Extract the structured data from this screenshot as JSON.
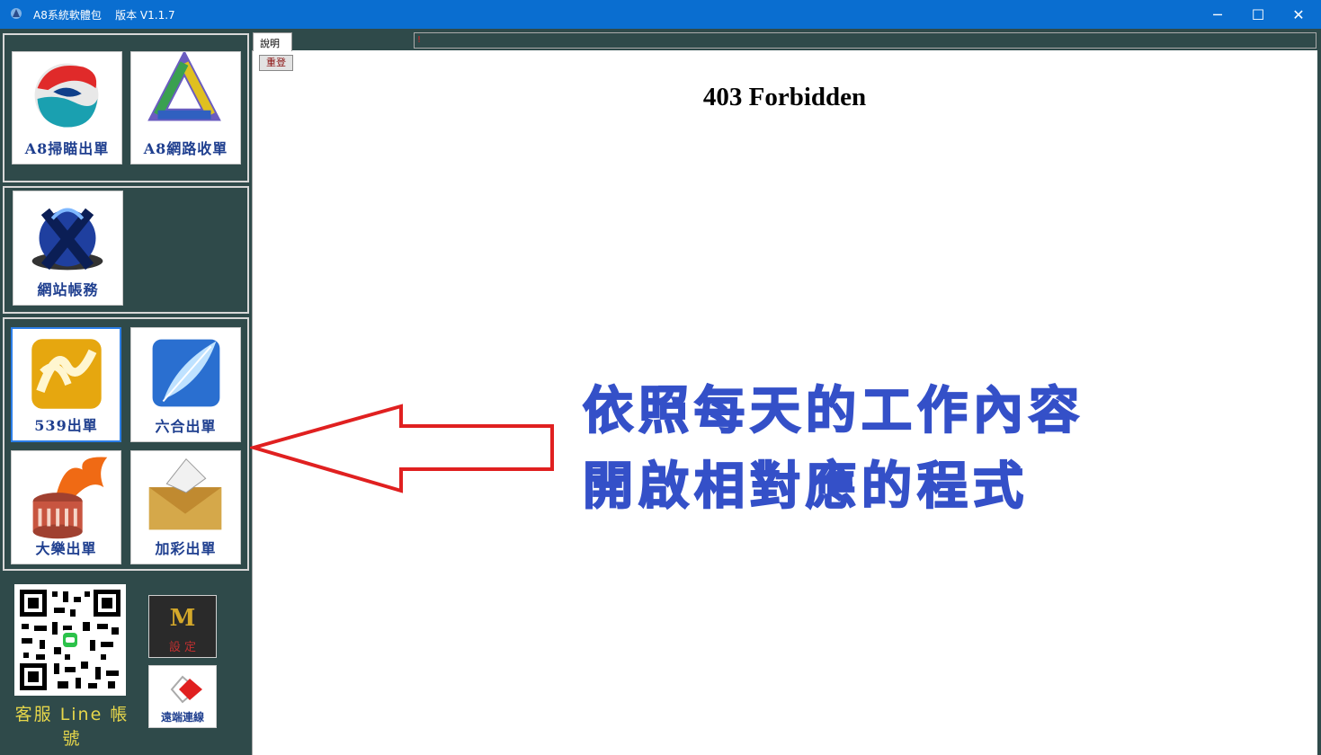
{
  "window": {
    "title": "A8系統軟體包    版本 V1.1.7",
    "minimize_glyph": "─",
    "maximize_glyph": "☐",
    "close_glyph": "✕"
  },
  "sidebar": {
    "tiles": [
      {
        "label": "A8掃瞄出單",
        "icon": "swirl-logo-icon"
      },
      {
        "label": "A8網路收單",
        "icon": "tri-ribbon-icon"
      },
      {
        "label": "網站帳務",
        "icon": "blue-x-globe-icon"
      },
      {
        "label": "539出單",
        "icon": "gold-swirl-icon"
      },
      {
        "label": "六合出單",
        "icon": "quill-icon"
      },
      {
        "label": "大樂出單",
        "icon": "fire-coliseum-icon"
      },
      {
        "label": "加彩出單",
        "icon": "paper-crane-icon"
      }
    ],
    "customer_service_label": "客服 Line 帳號",
    "settings_button": {
      "letter": "M",
      "label": "設 定"
    },
    "remote_button": {
      "label": "遠端連線"
    }
  },
  "browser": {
    "tab_label": "說明",
    "address_marker": "!",
    "reset_button": "重登",
    "page_heading": "403 Forbidden"
  },
  "instructions": {
    "line1": "依照每天的工作內容",
    "line2": "開啟相對應的程式"
  },
  "colors": {
    "titlebar": "#0a6ed0",
    "sidebar_bg": "#2f4a4a",
    "tile_label": "#1f3f8f",
    "instruction_text": "#3450c8",
    "arrow": "#e02020",
    "cs_label": "#e6d64a"
  }
}
